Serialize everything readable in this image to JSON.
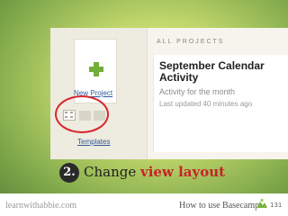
{
  "screenshot": {
    "section_label": "ALL PROJECTS",
    "new_project_label": "New Project",
    "templates_label": "Templates",
    "layout_switch": [
      "grid-icon",
      "list-icon",
      "list-icon"
    ],
    "project_card": {
      "title_line1": "September Calendar",
      "title_line2": "Activity",
      "description": "Activity for the month",
      "updated": "Last updated 40 minutes ago"
    },
    "accent_color": "#73ad3a",
    "highlight_color": "#d8262d"
  },
  "caption": {
    "step": "2.",
    "text": "Change ",
    "emphasis": "view layout",
    "emphasis_color": "#c82228"
  },
  "footer": {
    "site": "learnwithabbie.com",
    "guide": "How to use Basecamp",
    "icon": "basecamp-logo-icon",
    "page": "131"
  }
}
